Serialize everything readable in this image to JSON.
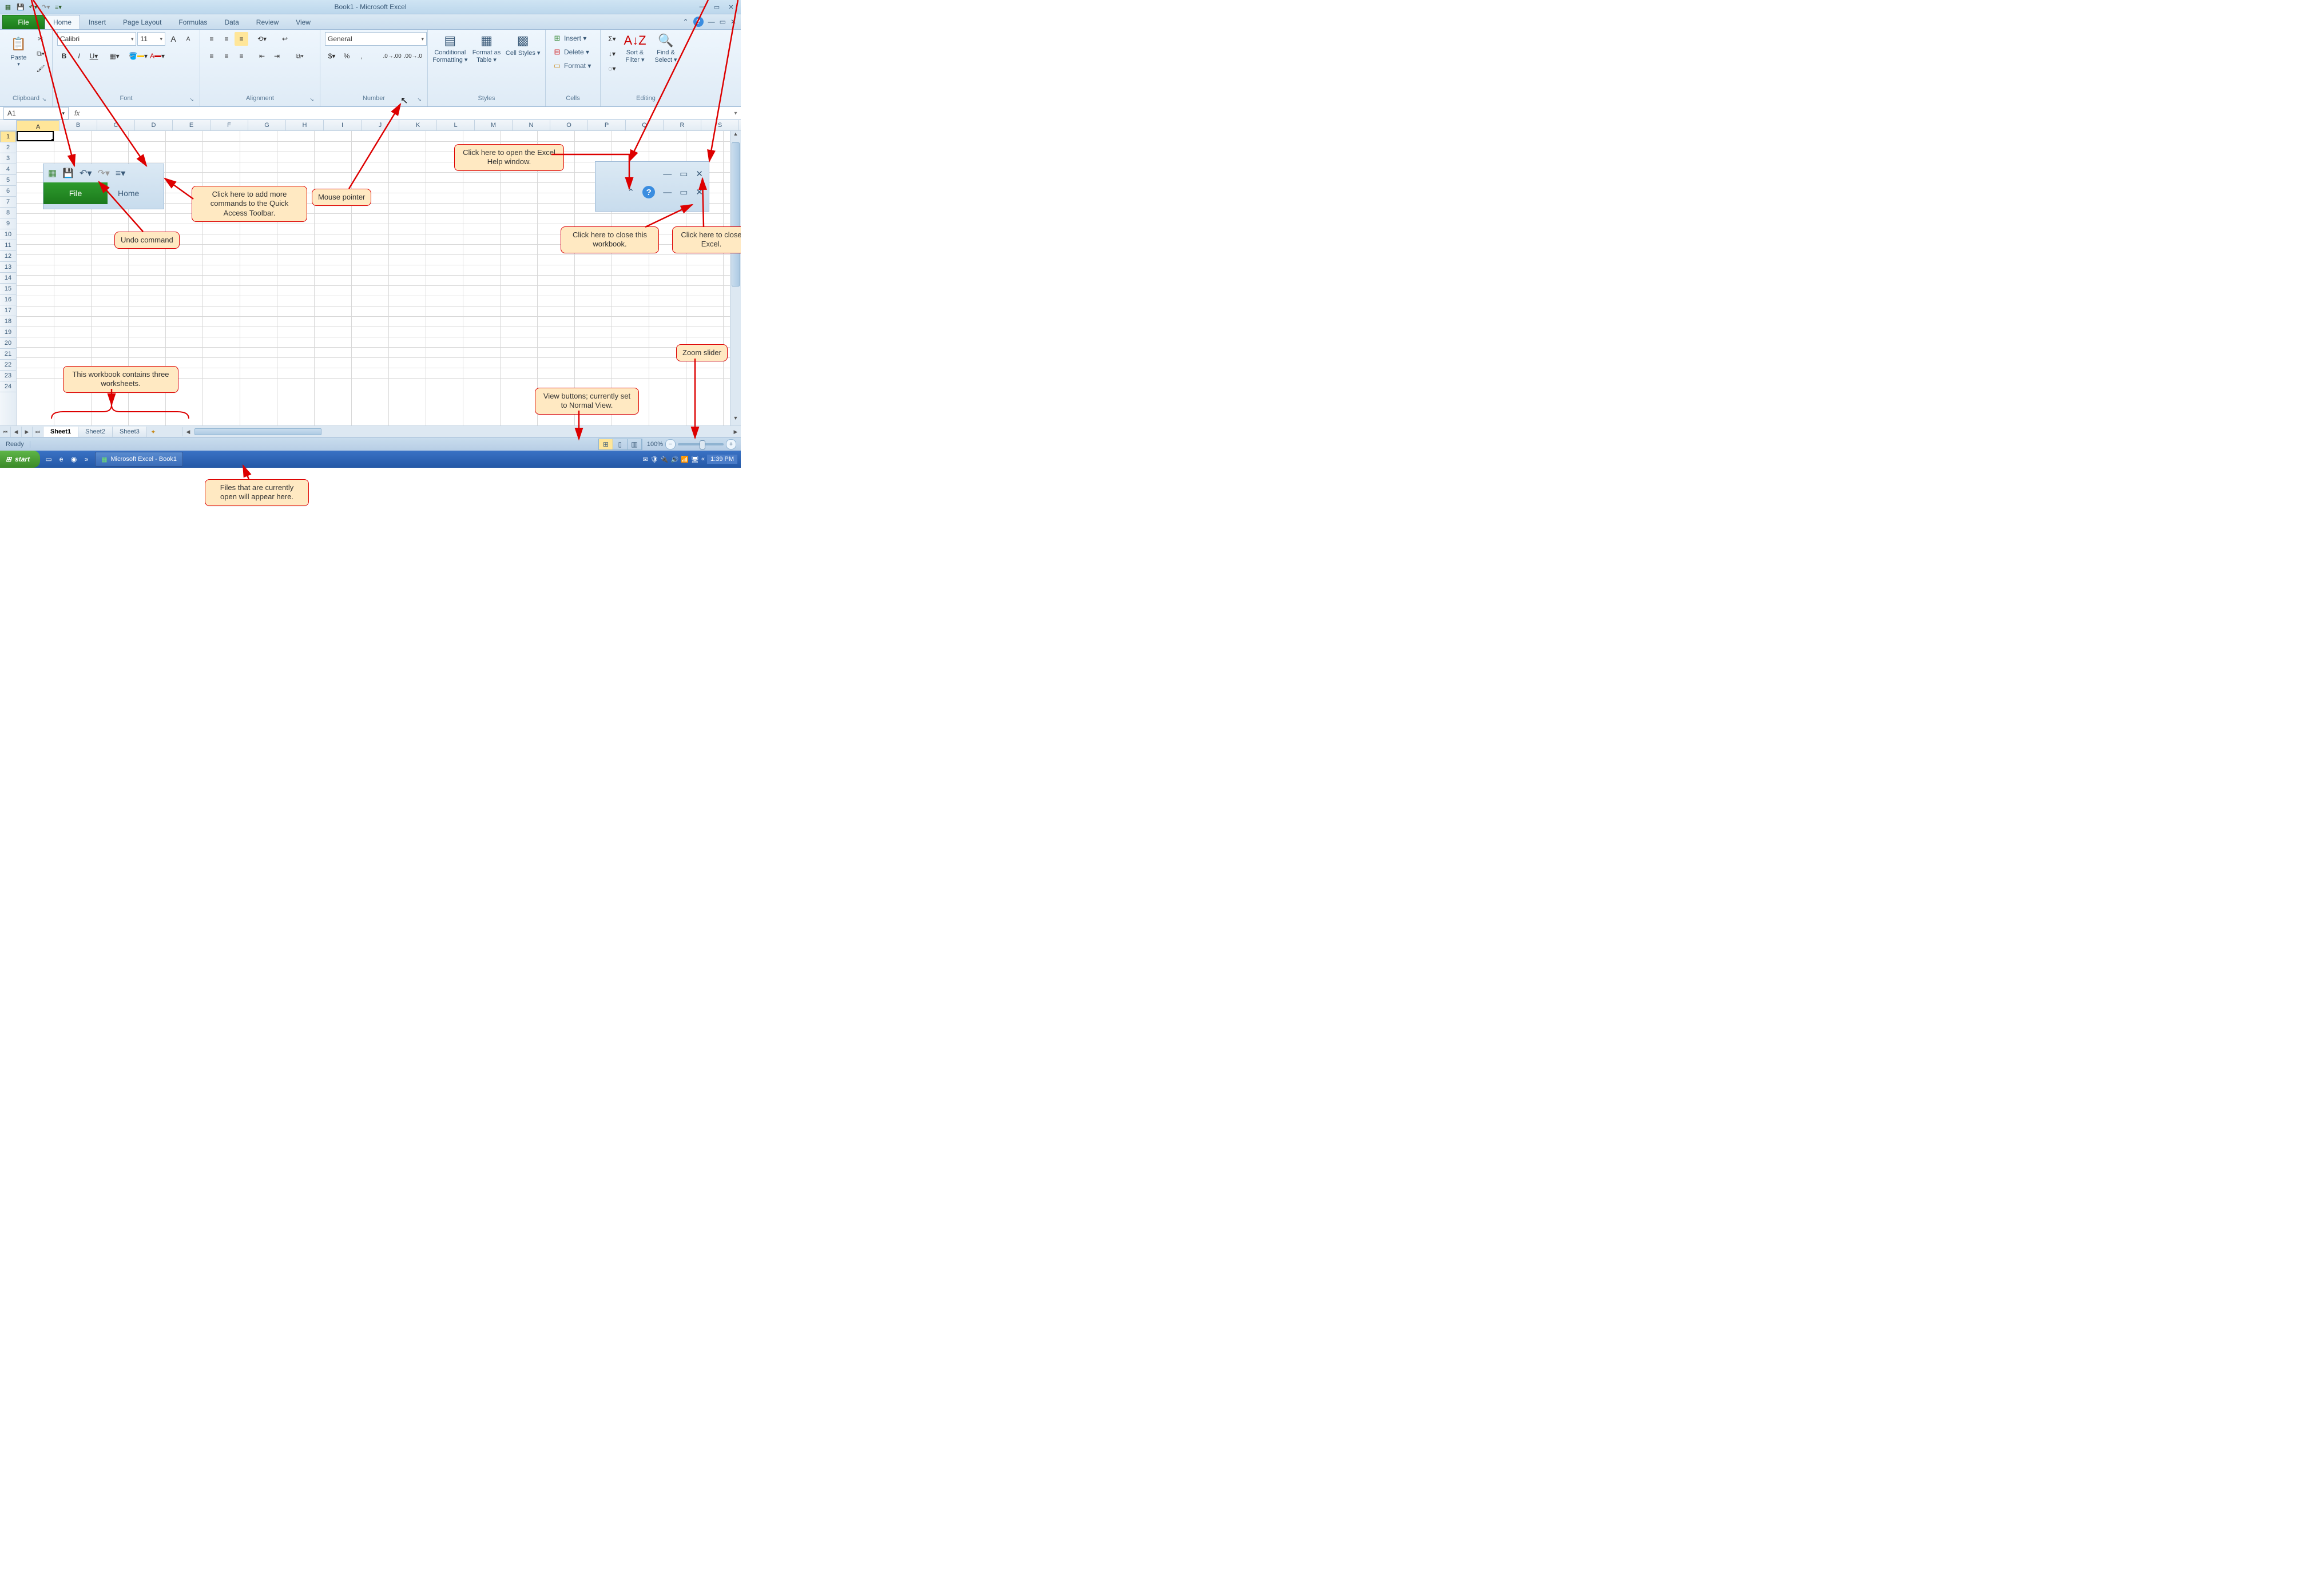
{
  "title": "Book1 - Microsoft Excel",
  "qa": {
    "save_tip": "Save",
    "undo_tip": "Undo",
    "redo_tip": "Redo",
    "more_tip": "Customize Quick Access Toolbar"
  },
  "window": {
    "min": "Minimize",
    "restore": "Restore",
    "close": "Close"
  },
  "tabs": {
    "file": "File",
    "items": [
      "Home",
      "Insert",
      "Page Layout",
      "Formulas",
      "Data",
      "Review",
      "View"
    ],
    "active": "Home",
    "collapse_tip": "Minimize Ribbon",
    "help_tip": "Help"
  },
  "ribbon": {
    "clipboard": {
      "label": "Clipboard",
      "paste": "Paste"
    },
    "font": {
      "label": "Font",
      "name": "Calibri",
      "size": "11"
    },
    "alignment": {
      "label": "Alignment"
    },
    "number": {
      "label": "Number",
      "format": "General"
    },
    "styles": {
      "label": "Styles",
      "cond": "Conditional Formatting ▾",
      "table": "Format as Table ▾",
      "cell": "Cell Styles ▾"
    },
    "cells": {
      "label": "Cells",
      "insert": "Insert ▾",
      "delete": "Delete ▾",
      "format": "Format ▾"
    },
    "editing": {
      "label": "Editing",
      "sort": "Sort & Filter ▾",
      "find": "Find & Select ▾"
    }
  },
  "formula_bar": {
    "namebox": "A1",
    "fx": "fx"
  },
  "grid": {
    "columns": [
      "A",
      "B",
      "C",
      "D",
      "E",
      "F",
      "G",
      "H",
      "I",
      "J",
      "K",
      "L",
      "M",
      "N",
      "O",
      "P",
      "Q",
      "R",
      "S"
    ],
    "rows_visible": 24,
    "active_cell": "A1"
  },
  "sheets": {
    "tabs": [
      "Sheet1",
      "Sheet2",
      "Sheet3"
    ],
    "active": "Sheet1"
  },
  "status": {
    "ready": "Ready",
    "zoom": "100%",
    "view_tip": "Normal"
  },
  "taskbar": {
    "start": "start",
    "task": "Microsoft Excel - Book1",
    "clock": "1:39 PM"
  },
  "callouts": {
    "qat_more": "Click here to add more commands to the Quick Access Toolbar.",
    "undo": "Undo command",
    "mouse": "Mouse pointer",
    "help": "Click here to open the Excel Help window.",
    "close_wb": "Click here to close this workbook.",
    "close_excel": "Click here to close Excel.",
    "zoom": "Zoom slider",
    "sheets": "This workbook contains three worksheets.",
    "views": "View buttons; currently set to Normal View.",
    "openfiles": "Files that are currently open will appear here."
  }
}
